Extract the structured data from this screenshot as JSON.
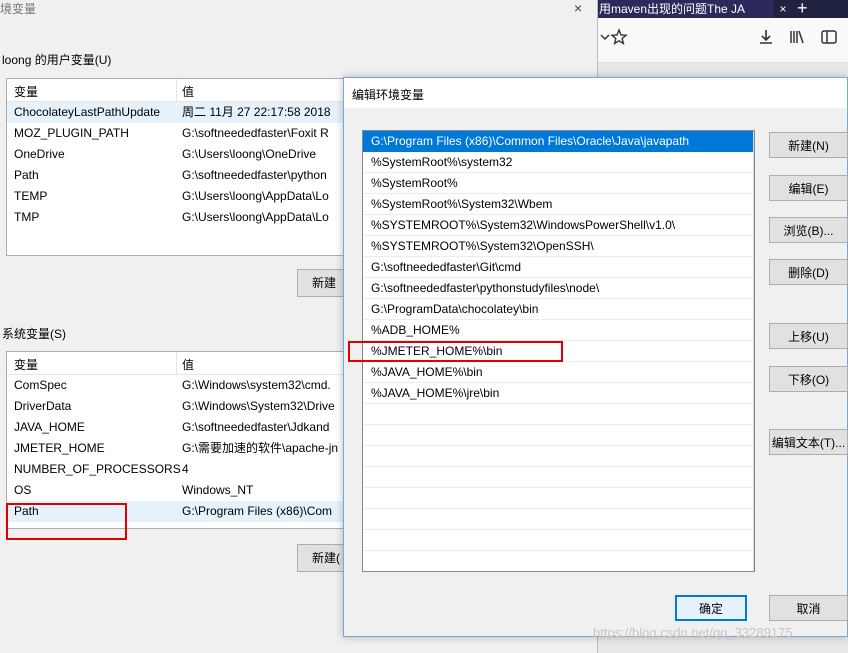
{
  "browser": {
    "tab_title": "用maven出现的问题The JA",
    "tab_close": "×",
    "new_tab": "+"
  },
  "env_window": {
    "title": "境变量",
    "close": "×",
    "user_group_label": "loong 的用户变量(U)",
    "system_group_label": "系统变量(S)",
    "col_name": "变量",
    "col_value": "值",
    "user_vars": [
      {
        "name": "ChocolateyLastPathUpdate",
        "value": "周二 11月 27 22:17:58 2018"
      },
      {
        "name": "MOZ_PLUGIN_PATH",
        "value": "G:\\softneededfaster\\Foxit R"
      },
      {
        "name": "OneDrive",
        "value": "G:\\Users\\loong\\OneDrive"
      },
      {
        "name": "Path",
        "value": "G:\\softneededfaster\\python"
      },
      {
        "name": "TEMP",
        "value": "G:\\Users\\loong\\AppData\\Lo"
      },
      {
        "name": "TMP",
        "value": "G:\\Users\\loong\\AppData\\Lo"
      }
    ],
    "system_vars": [
      {
        "name": "ComSpec",
        "value": "G:\\Windows\\system32\\cmd."
      },
      {
        "name": "DriverData",
        "value": "G:\\Windows\\System32\\Drive"
      },
      {
        "name": "JAVA_HOME",
        "value": "G:\\softneededfaster\\Jdkand"
      },
      {
        "name": "JMETER_HOME",
        "value": "G:\\需要加速的软件\\apache-jn"
      },
      {
        "name": "NUMBER_OF_PROCESSORS",
        "value": "4"
      },
      {
        "name": "OS",
        "value": "Windows_NT"
      },
      {
        "name": "Path",
        "value": "G:\\Program Files (x86)\\Com"
      }
    ],
    "user_new_button": "新建",
    "system_new_button": "新建("
  },
  "edit_dialog": {
    "title": "编辑环境变量",
    "entries": [
      "G:\\Program Files (x86)\\Common Files\\Oracle\\Java\\javapath",
      "%SystemRoot%\\system32",
      "%SystemRoot%",
      "%SystemRoot%\\System32\\Wbem",
      "%SYSTEMROOT%\\System32\\WindowsPowerShell\\v1.0\\",
      "%SYSTEMROOT%\\System32\\OpenSSH\\",
      "G:\\softneededfaster\\Git\\cmd",
      "G:\\softneededfaster\\pythonstudyfiles\\node\\",
      "G:\\ProgramData\\chocolatey\\bin",
      "%ADB_HOME%",
      "%JMETER_HOME%\\bin",
      "%JAVA_HOME%\\bin",
      "%JAVA_HOME%\\jre\\bin"
    ],
    "buttons": {
      "new": "新建(N)",
      "edit": "编辑(E)",
      "browse": "浏览(B)...",
      "delete": "删除(D)",
      "move_up": "上移(U)",
      "move_down": "下移(O)",
      "edit_text": "编辑文本(T)...",
      "ok": "确定",
      "cancel": "取消"
    }
  },
  "watermark": "https://blog.csdn.net/qq_33289175",
  "colors": {
    "selection": "#0078d7",
    "highlight_box": "#e00000"
  }
}
